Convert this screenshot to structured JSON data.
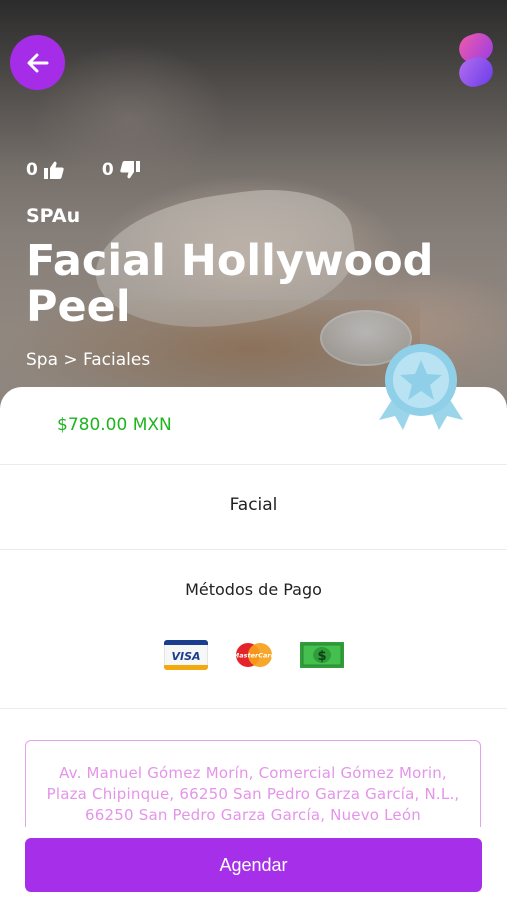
{
  "header": {
    "back_icon": "arrow-left-icon",
    "logo_icon": "app-logo-s-icon",
    "colors": {
      "accent": "#a52de8"
    }
  },
  "votes": {
    "likes": "0",
    "dislikes": "0"
  },
  "service": {
    "provider": "SPAu",
    "title": "Facial Hollywood Peel",
    "breadcrumb": "Spa > Faciales",
    "price": "$780.00 MXN",
    "category": "Facial"
  },
  "payments": {
    "title": "Métodos de Pago",
    "methods": [
      {
        "icon": "visa-card-icon",
        "label": "VISA"
      },
      {
        "icon": "mastercard-icon",
        "label": "MasterCard"
      },
      {
        "icon": "cash-icon",
        "label": "$"
      }
    ]
  },
  "address": {
    "text": "Av. Manuel Gómez Morín, Comercial Gómez Morin, Plaza Chipinque, 66250 San Pedro Garza García, N.L., 66250 San Pedro Garza García, Nuevo León"
  },
  "cta": {
    "label": "Agendar"
  },
  "colors": {
    "price": "#1fb51f",
    "button": "#a630ea",
    "address_border": "#e3a2ee"
  }
}
